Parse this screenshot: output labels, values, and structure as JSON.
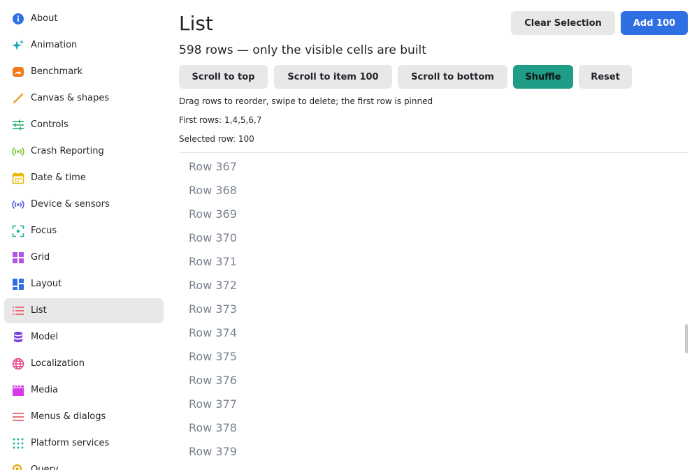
{
  "sidebar": {
    "items": [
      {
        "label": "About",
        "icon": "info-icon",
        "color": "#2f6fe4"
      },
      {
        "label": "Animation",
        "icon": "sparkle-icon",
        "color": "#17a6b8"
      },
      {
        "label": "Benchmark",
        "icon": "speedometer-icon",
        "color": "#f07a1a"
      },
      {
        "label": "Canvas & shapes",
        "icon": "brush-icon",
        "color": "#f0a030"
      },
      {
        "label": "Controls",
        "icon": "sliders-icon",
        "color": "#2aa86a"
      },
      {
        "label": "Crash Reporting",
        "icon": "broadcast-icon",
        "color": "#7ac22a"
      },
      {
        "label": "Date & time",
        "icon": "calendar-icon",
        "color": "#e5b800"
      },
      {
        "label": "Device & sensors",
        "icon": "sensor-icon",
        "color": "#5a5ae0"
      },
      {
        "label": "Focus",
        "icon": "focus-icon",
        "color": "#1fb5a0"
      },
      {
        "label": "Grid",
        "icon": "grid-icon",
        "color": "#b055e8"
      },
      {
        "label": "Layout",
        "icon": "layout-icon",
        "color": "#2f6fe4"
      },
      {
        "label": "List",
        "icon": "list-icon",
        "color": "#e8505b",
        "active": true
      },
      {
        "label": "Model",
        "icon": "database-icon",
        "color": "#7a3fe0"
      },
      {
        "label": "Localization",
        "icon": "globe-icon",
        "color": "#e0408a"
      },
      {
        "label": "Media",
        "icon": "clapperboard-icon",
        "color": "#d838e8"
      },
      {
        "label": "Menus & dialogs",
        "icon": "menu-icon",
        "color": "#e8505b"
      },
      {
        "label": "Platform services",
        "icon": "apps-icon",
        "color": "#1fb5a0"
      },
      {
        "label": "Query",
        "icon": "search-icon",
        "color": "#e5a000"
      }
    ]
  },
  "header": {
    "title": "List",
    "clear_selection_label": "Clear Selection",
    "add_label": "Add 100"
  },
  "summary": "598 rows — only the visible cells are built",
  "toolbar": {
    "scroll_top_label": "Scroll to top",
    "scroll_item_label": "Scroll to item 100",
    "scroll_bottom_label": "Scroll to bottom",
    "shuffle_label": "Shuffle",
    "reset_label": "Reset"
  },
  "hint": "Drag rows to reorder, swipe to delete; the first row is pinned",
  "first_rows": "First rows: 1,4,5,6,7",
  "selected_row": "Selected row: 100",
  "rows": [
    "Row 367",
    "Row 368",
    "Row 369",
    "Row 370",
    "Row 371",
    "Row 372",
    "Row 373",
    "Row 374",
    "Row 375",
    "Row 376",
    "Row 377",
    "Row 378",
    "Row 379"
  ],
  "colors": {
    "primary": "#2f6fe4",
    "accent": "#1f9d86",
    "active_bg": "#e8e8e8",
    "row_text": "#7a8290"
  }
}
